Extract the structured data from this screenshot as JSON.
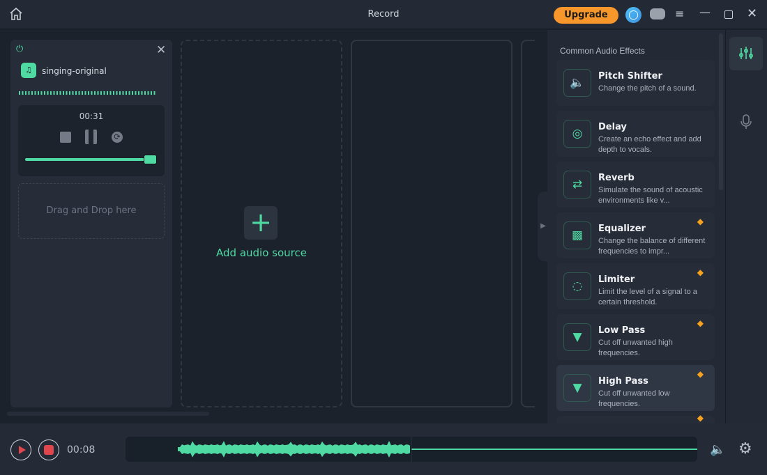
{
  "titlebar": {
    "title": "Record",
    "upgrade_label": "Upgrade"
  },
  "source_card": {
    "name": "singing-original",
    "time": "00:31",
    "level_percent": 90,
    "progress_percent": 92,
    "drop_label": "Drag and Drop here"
  },
  "add_source": {
    "label": "Add audio source"
  },
  "effects": {
    "heading": "Common Audio Effects",
    "items": [
      {
        "title": "Pitch Shifter",
        "desc": "Change the pitch of a sound.",
        "icon": "speaker-icon",
        "premium": false
      },
      {
        "title": "Delay",
        "desc": "Create an echo effect and add depth to vocals.",
        "icon": "echo-icon",
        "premium": false
      },
      {
        "title": "Reverb",
        "desc": "Simulate the sound of acoustic environments like v...",
        "icon": "shuffle-icon",
        "premium": false
      },
      {
        "title": "Equalizer",
        "desc": "Change the balance of different frequencies to impr...",
        "icon": "bars-icon",
        "premium": true
      },
      {
        "title": "Limiter",
        "desc": "Limit the level of a signal to a certain threshold.",
        "icon": "circle-nodes-icon",
        "premium": true
      },
      {
        "title": "Low Pass",
        "desc": "Cut off unwanted high frequencies.",
        "icon": "filter-icon",
        "premium": true
      },
      {
        "title": "High Pass",
        "desc": "Cut off unwanted low frequencies.",
        "icon": "filter-icon",
        "premium": true
      }
    ]
  },
  "bottom": {
    "time": "00:08",
    "progress_percent": 50
  },
  "colors": {
    "accent": "#4fd9a3",
    "upgrade": "#f7962a",
    "record": "#e0474c"
  }
}
